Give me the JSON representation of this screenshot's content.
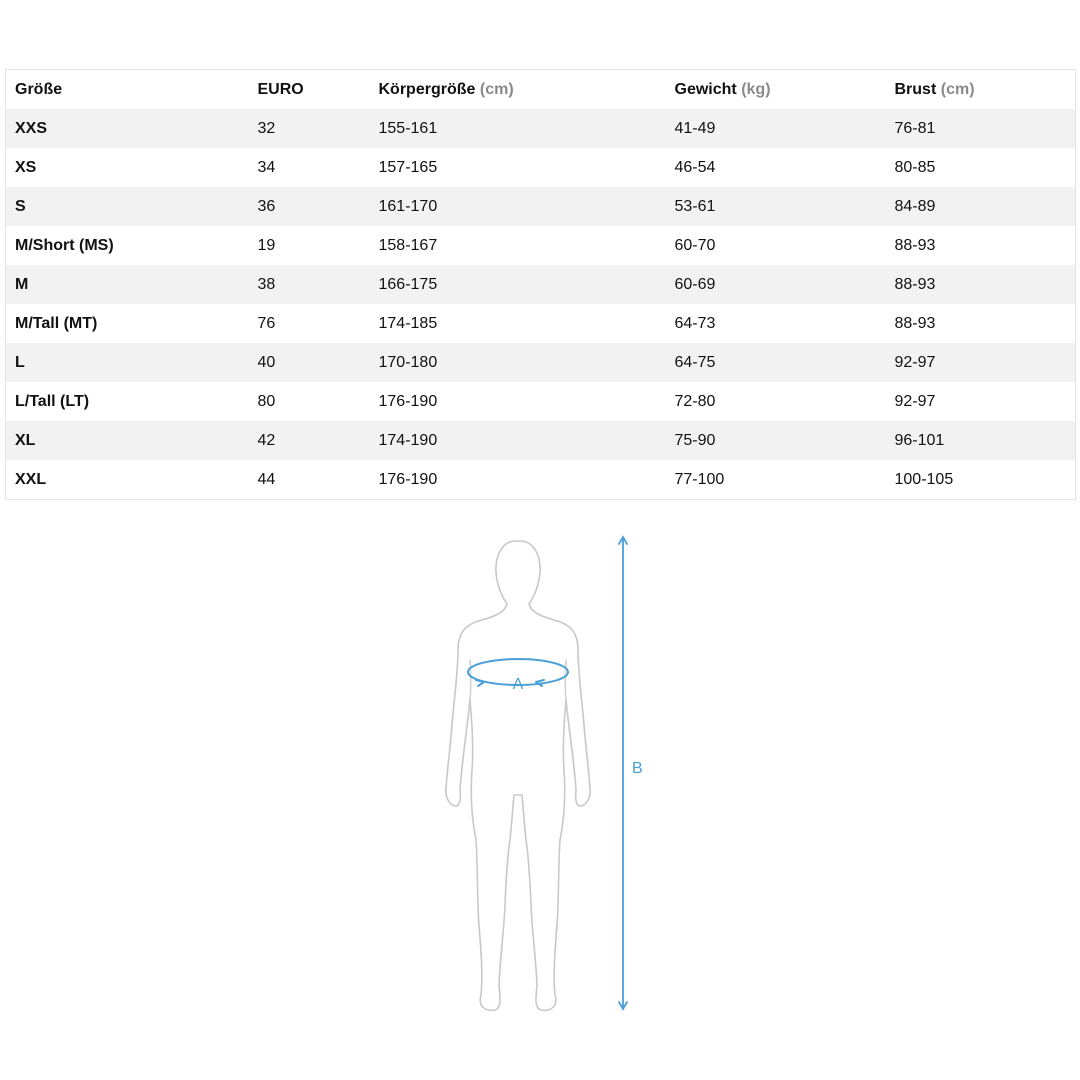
{
  "table": {
    "headers": [
      {
        "label": "Größe",
        "unit": ""
      },
      {
        "label": "EURO",
        "unit": ""
      },
      {
        "label": "Körpergröße",
        "unit": "(cm)"
      },
      {
        "label": "Gewicht",
        "unit": "(kg)"
      },
      {
        "label": "Brust",
        "unit": "(cm)"
      }
    ],
    "rows": [
      [
        "XXS",
        "32",
        "155-161",
        "41-49",
        "76-81"
      ],
      [
        "XS",
        "34",
        "157-165",
        "46-54",
        "80-85"
      ],
      [
        "S",
        "36",
        "161-170",
        "53-61",
        "84-89"
      ],
      [
        "M/Short (MS)",
        "19",
        "158-167",
        "60-70",
        "88-93"
      ],
      [
        "M",
        "38",
        "166-175",
        "60-69",
        "88-93"
      ],
      [
        "M/Tall (MT)",
        "76",
        "174-185",
        "64-73",
        "88-93"
      ],
      [
        "L",
        "40",
        "170-180",
        "64-75",
        "92-97"
      ],
      [
        "L/Tall (LT)",
        "80",
        "176-190",
        "72-80",
        "92-97"
      ],
      [
        "XL",
        "42",
        "174-190",
        "75-90",
        "96-101"
      ],
      [
        "XXL",
        "44",
        "176-190",
        "77-100",
        "100-105"
      ]
    ]
  },
  "diagram": {
    "label_chest": "A",
    "label_height": "B",
    "measure_color": "#4a9fd8",
    "outline_color": "#c8c8c8"
  }
}
